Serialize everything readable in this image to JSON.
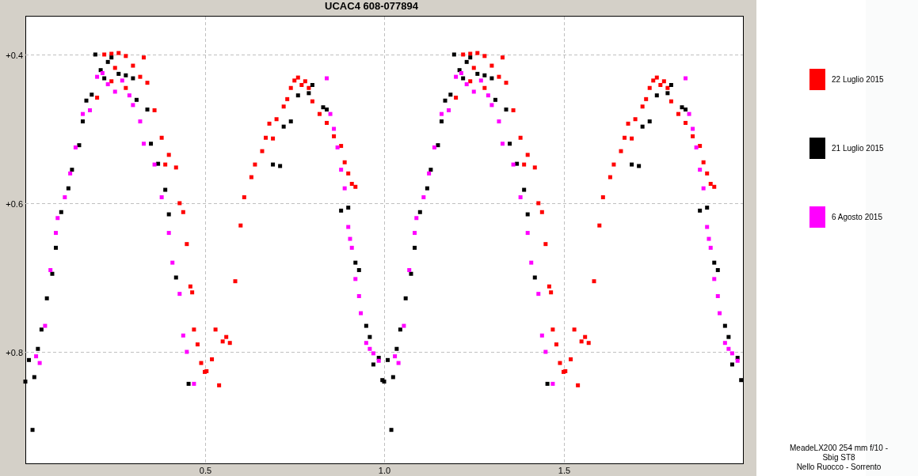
{
  "title": "UCAC4 608-077894",
  "chart": {
    "chart_data": {
      "type": "scatter",
      "grid": true,
      "xlim": [
        0,
        2
      ],
      "ylim": [
        0.95,
        0.349
      ],
      "xticks": [
        {
          "value": 0.5,
          "label": "0.5"
        },
        {
          "value": 1.0,
          "label": "1.0"
        },
        {
          "value": 1.5,
          "label": "1.5"
        }
      ],
      "yticks": [
        {
          "value": 0.4,
          "label": "+0.4"
        },
        {
          "value": 0.6,
          "label": "+0.6"
        },
        {
          "value": 0.8,
          "label": "+0.8"
        }
      ],
      "series": [
        {
          "name": "22 Luglio 2015",
          "color": "#ff0000",
          "x": [
            0.22,
            0.24,
            0.26,
            0.28,
            0.3,
            0.33,
            0.25,
            0.32,
            0.34,
            0.36,
            0.38,
            0.4,
            0.42,
            0.39,
            0.43,
            0.44,
            0.45,
            0.46,
            0.465,
            0.47,
            0.48,
            0.49,
            0.5,
            0.505,
            0.52,
            0.53,
            0.55,
            0.56,
            0.57,
            0.54,
            0.585,
            0.6,
            0.61,
            0.63,
            0.64,
            0.66,
            0.67,
            0.68,
            0.69,
            0.7,
            0.72,
            0.73,
            0.74,
            0.75,
            0.76,
            0.77,
            0.78,
            0.79,
            0.8,
            0.82,
            0.84,
            0.86,
            0.88,
            0.89,
            0.9,
            0.91,
            0.92,
            0.24,
            0.28,
            0.2,
            1.22,
            1.24,
            1.26,
            1.28,
            1.3,
            1.33,
            1.25,
            1.32,
            1.34,
            1.36,
            1.38,
            1.4,
            1.42,
            1.39,
            1.43,
            1.44,
            1.45,
            1.46,
            1.465,
            1.47,
            1.48,
            1.49,
            1.5,
            1.505,
            1.52,
            1.53,
            1.55,
            1.56,
            1.57,
            1.54,
            1.585,
            1.6,
            1.61,
            1.63,
            1.64,
            1.66,
            1.67,
            1.68,
            1.69,
            1.7,
            1.72,
            1.73,
            1.74,
            1.75,
            1.76,
            1.77,
            1.78,
            1.79,
            1.8,
            1.82,
            1.84,
            1.86,
            1.88,
            1.89,
            1.9,
            1.91,
            1.92,
            1.24,
            1.28,
            1.2
          ],
          "values": [
            0.4,
            0.399,
            0.398,
            0.402,
            0.415,
            0.404,
            0.418,
            0.43,
            0.438,
            0.475,
            0.512,
            0.535,
            0.552,
            0.548,
            0.6,
            0.612,
            0.655,
            0.712,
            0.72,
            0.77,
            0.79,
            0.815,
            0.827,
            0.826,
            0.81,
            0.77,
            0.786,
            0.78,
            0.788,
            0.845,
            0.705,
            0.63,
            0.592,
            0.565,
            0.548,
            0.53,
            0.512,
            0.493,
            0.513,
            0.487,
            0.47,
            0.46,
            0.445,
            0.435,
            0.431,
            0.441,
            0.436,
            0.445,
            0.463,
            0.48,
            0.492,
            0.51,
            0.523,
            0.545,
            0.56,
            0.574,
            0.578,
            0.436,
            0.445,
            0.458,
            0.4,
            0.399,
            0.398,
            0.402,
            0.415,
            0.404,
            0.418,
            0.43,
            0.438,
            0.475,
            0.512,
            0.535,
            0.552,
            0.548,
            0.6,
            0.612,
            0.655,
            0.712,
            0.72,
            0.77,
            0.79,
            0.815,
            0.827,
            0.826,
            0.81,
            0.77,
            0.786,
            0.78,
            0.788,
            0.845,
            0.705,
            0.63,
            0.592,
            0.565,
            0.548,
            0.53,
            0.512,
            0.493,
            0.513,
            0.487,
            0.47,
            0.46,
            0.445,
            0.435,
            0.431,
            0.441,
            0.436,
            0.445,
            0.463,
            0.48,
            0.492,
            0.51,
            0.523,
            0.545,
            0.56,
            0.574,
            0.578,
            0.436,
            0.445,
            0.458
          ]
        },
        {
          "name": "21 Luglio 2015",
          "color": "#000000",
          "x": [
            0,
            0.01,
            0.02,
            0.025,
            0.035,
            0.045,
            0.06,
            0.075,
            0.085,
            0.1,
            0.12,
            0.13,
            0.15,
            0.16,
            0.17,
            0.185,
            0.195,
            0.21,
            0.22,
            0.23,
            0.24,
            0.26,
            0.28,
            0.3,
            0.31,
            0.34,
            0.35,
            0.37,
            0.39,
            0.4,
            0.42,
            0.455,
            0.69,
            0.71,
            0.72,
            0.74,
            0.76,
            0.79,
            0.8,
            0.83,
            0.84,
            0.88,
            0.9,
            0.92,
            0.93,
            0.95,
            0.96,
            0.97,
            0.985,
            0.995,
            1,
            1.01,
            1.02,
            1.025,
            1.035,
            1.045,
            1.06,
            1.075,
            1.085,
            1.1,
            1.12,
            1.13,
            1.15,
            1.16,
            1.17,
            1.185,
            1.195,
            1.21,
            1.22,
            1.23,
            1.24,
            1.26,
            1.28,
            1.3,
            1.31,
            1.34,
            1.35,
            1.37,
            1.39,
            1.4,
            1.42,
            1.455,
            1.69,
            1.71,
            1.72,
            1.74,
            1.76,
            1.79,
            1.8,
            1.83,
            1.84,
            1.88,
            1.9,
            1.92,
            1.93,
            1.95,
            1.96,
            1.97,
            1.985,
            1.995
          ],
          "values": [
            0.84,
            0.811,
            0.905,
            0.834,
            0.796,
            0.77,
            0.728,
            0.695,
            0.66,
            0.612,
            0.58,
            0.555,
            0.522,
            0.49,
            0.462,
            0.454,
            0.4,
            0.421,
            0.432,
            0.41,
            0.404,
            0.426,
            0.428,
            0.432,
            0.461,
            0.474,
            0.52,
            0.547,
            0.582,
            0.615,
            0.7,
            0.843,
            0.548,
            0.55,
            0.497,
            0.49,
            0.455,
            0.452,
            0.441,
            0.471,
            0.474,
            0.61,
            0.606,
            0.68,
            0.69,
            0.765,
            0.78,
            0.817,
            0.808,
            0.838,
            0.84,
            0.811,
            0.905,
            0.834,
            0.796,
            0.77,
            0.728,
            0.695,
            0.66,
            0.612,
            0.58,
            0.555,
            0.522,
            0.49,
            0.462,
            0.454,
            0.4,
            0.421,
            0.432,
            0.41,
            0.404,
            0.426,
            0.428,
            0.432,
            0.461,
            0.474,
            0.52,
            0.547,
            0.582,
            0.615,
            0.7,
            0.843,
            0.548,
            0.55,
            0.497,
            0.49,
            0.455,
            0.452,
            0.441,
            0.471,
            0.474,
            0.61,
            0.606,
            0.68,
            0.69,
            0.765,
            0.78,
            0.817,
            0.808,
            0.838
          ]
        },
        {
          "name": "6 Agosto 2015",
          "color": "#ff00ff",
          "x": [
            0.03,
            0.04,
            0.055,
            0.07,
            0.085,
            0.09,
            0.11,
            0.125,
            0.14,
            0.16,
            0.18,
            0.2,
            0.215,
            0.23,
            0.25,
            0.27,
            0.29,
            0.3,
            0.32,
            0.33,
            0.36,
            0.38,
            0.4,
            0.41,
            0.43,
            0.44,
            0.45,
            0.47,
            0.84,
            0.85,
            0.86,
            0.87,
            0.88,
            0.89,
            0.9,
            0.905,
            0.91,
            0.92,
            0.93,
            0.935,
            0.95,
            0.96,
            0.97,
            0.985,
            1.03,
            1.04,
            1.055,
            1.07,
            1.085,
            1.09,
            1.11,
            1.125,
            1.14,
            1.16,
            1.18,
            1.2,
            1.215,
            1.23,
            1.25,
            1.27,
            1.29,
            1.3,
            1.32,
            1.33,
            1.36,
            1.38,
            1.4,
            1.41,
            1.43,
            1.44,
            1.45,
            1.47,
            1.84,
            1.85,
            1.86,
            1.87,
            1.88,
            1.89,
            1.9,
            1.905,
            1.91,
            1.92,
            1.93,
            1.935,
            1.95,
            1.96,
            1.97,
            1.985
          ],
          "values": [
            0.806,
            0.815,
            0.765,
            0.69,
            0.64,
            0.62,
            0.592,
            0.56,
            0.525,
            0.48,
            0.475,
            0.43,
            0.425,
            0.44,
            0.45,
            0.435,
            0.455,
            0.468,
            0.49,
            0.52,
            0.548,
            0.592,
            0.64,
            0.68,
            0.722,
            0.778,
            0.8,
            0.843,
            0.432,
            0.48,
            0.5,
            0.525,
            0.555,
            0.58,
            0.632,
            0.648,
            0.66,
            0.702,
            0.725,
            0.748,
            0.788,
            0.796,
            0.802,
            0.812,
            0.806,
            0.815,
            0.765,
            0.69,
            0.64,
            0.62,
            0.592,
            0.56,
            0.525,
            0.48,
            0.475,
            0.43,
            0.425,
            0.44,
            0.45,
            0.435,
            0.455,
            0.468,
            0.49,
            0.52,
            0.548,
            0.592,
            0.64,
            0.68,
            0.722,
            0.778,
            0.8,
            0.843,
            0.432,
            0.48,
            0.5,
            0.525,
            0.555,
            0.58,
            0.632,
            0.648,
            0.66,
            0.702,
            0.725,
            0.748,
            0.788,
            0.796,
            0.802,
            0.812
          ]
        }
      ]
    }
  },
  "credits": [
    "MeadeLX200 254 mm f/10 -",
    "Sbig ST8",
    "Nello Ruocco - Sorrento"
  ]
}
